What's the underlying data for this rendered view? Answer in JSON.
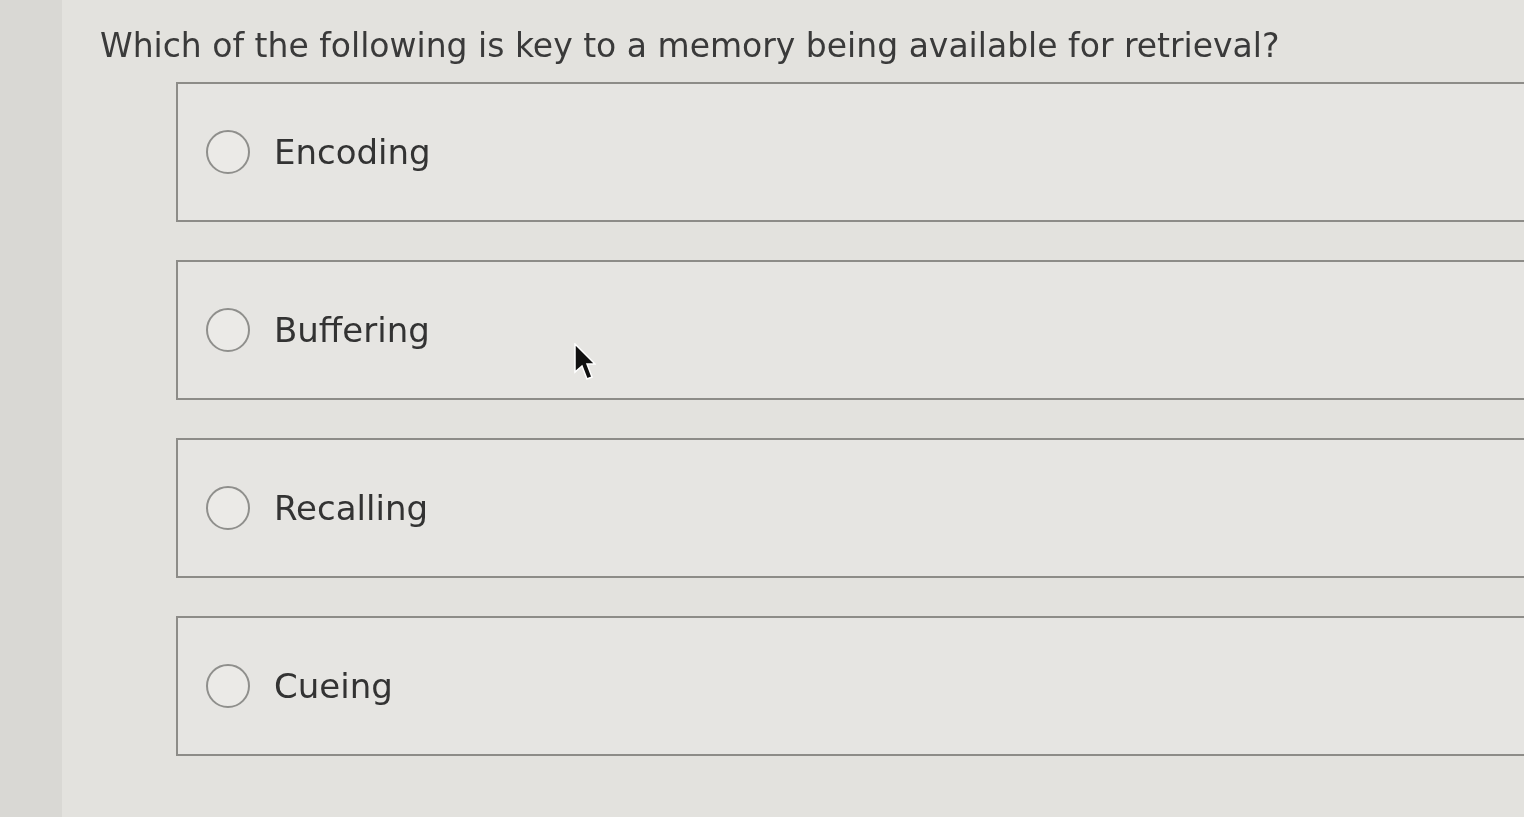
{
  "question": "Which of the following is key to a memory being available for retrieval?",
  "options": [
    {
      "label": "Encoding",
      "selected": false
    },
    {
      "label": "Buffering",
      "selected": false
    },
    {
      "label": "Recalling",
      "selected": false
    },
    {
      "label": "Cueing",
      "selected": false
    }
  ]
}
